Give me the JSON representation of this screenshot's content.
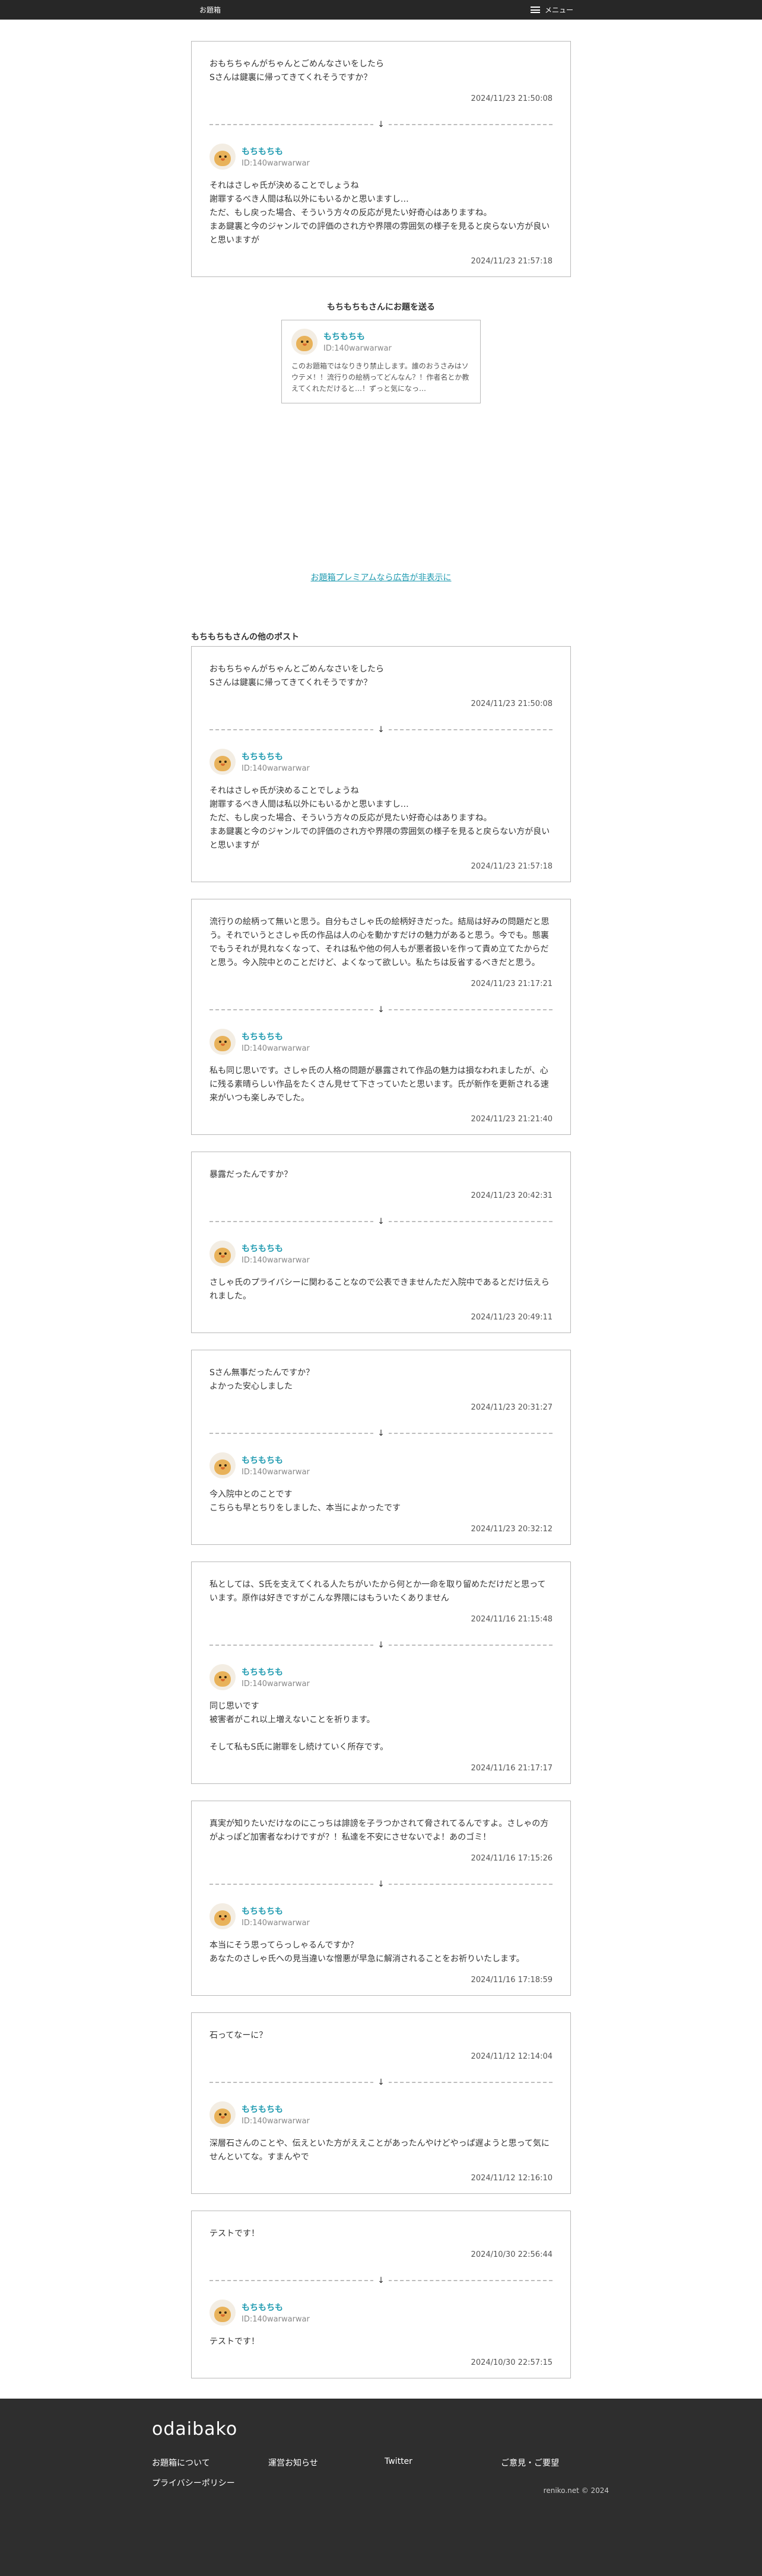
{
  "header": {
    "site_title": "お題箱",
    "menu_label": "メニュー"
  },
  "main_post": {
    "question": "おもちちゃんがちゃんとごめんなさいをしたら\nSさんは鍵裏に帰ってきてくれそうですか？",
    "question_time": "2024/11/23 21:50:08",
    "author_name": "もちもちも",
    "author_id": "ID:140warwarwar",
    "answer": "それはさしゃ氏が決めることでしょうね\n謝罪するべき人間は私以外にもいるかと思いますし…\nただ、もし戻った場合、そういう方々の反応が見たい好奇心はありますね。\nまあ鍵裏と今のジャンルでの評価のされ方や界隈の雰囲気の様子を見ると戻らない方が良いと思いますが",
    "answer_time": "2024/11/23 21:57:18"
  },
  "share": {
    "title": "もちもちもさんにお題を送る",
    "author_name": "もちもちも",
    "author_id": "ID:140warwarwar",
    "bio": "このお題箱ではなりきり禁止します。誰のおうさみはソウテメ！！流行りの絵柄ってどんなん？！作者名とか教えてくれただけると…！ずっと気になっ…"
  },
  "ad_link": "お題箱プレミアムなら広告が非表示に",
  "other_posts_title": "もちもちもさんの他のポスト",
  "posts": [
    {
      "question": "おもちちゃんがちゃんとごめんなさいをしたら\nSさんは鍵裏に帰ってきてくれそうですか？",
      "question_time": "2024/11/23 21:50:08",
      "author_name": "もちもちも",
      "author_id": "ID:140warwarwar",
      "answer": "それはさしゃ氏が決めることでしょうね\n謝罪するべき人間は私以外にもいるかと思いますし…\nただ、もし戻った場合、そういう方々の反応が見たい好奇心はありますね。\nまあ鍵裏と今のジャンルでの評価のされ方や界隈の雰囲気の様子を見ると戻らない方が良いと思いますが",
      "answer_time": "2024/11/23 21:57:18"
    },
    {
      "question": "流行りの絵柄って無いと思う。自分もさしゃ氏の絵柄好きだった。結局は好みの問題だと思う。それでいうとさしゃ氏の作品は人の心を動かすだけの魅力があると思う。今でも。態裏でもうそれが見れなくなって、それは私や他の何人もが悪者扱いを作って責め立てたからだと思う。今入院中とのことだけど、よくなって欲しい。私たちは反省するべきだと思う。",
      "question_time": "2024/11/23 21:17:21",
      "author_name": "もちもちも",
      "author_id": "ID:140warwarwar",
      "answer": "私も同じ思いです。さしゃ氏の人格の問題が暴露されて作品の魅力は損なわれましたが、心に残る素晴らしい作品をたくさん見せて下さっていたと思います。氏が新作を更新される速来がいつも楽しみでした。",
      "answer_time": "2024/11/23 21:21:40"
    },
    {
      "question": "暴露だったんですか？",
      "question_time": "2024/11/23 20:42:31",
      "author_name": "もちもちも",
      "author_id": "ID:140warwarwar",
      "answer": "さしゃ氏のプライバシーに関わることなので公表できませんただ入院中であるとだけ伝えられました。",
      "answer_time": "2024/11/23 20:49:11"
    },
    {
      "question": "Sさん無事だったんですか？\nよかった安心しました",
      "question_time": "2024/11/23 20:31:27",
      "author_name": "もちもちも",
      "author_id": "ID:140warwarwar",
      "answer": "今入院中とのことです\nこちらも早とちりをしました、本当によかったです",
      "answer_time": "2024/11/23 20:32:12"
    },
    {
      "question": "私としては、S氏を支えてくれる人たちがいたから何とか一命を取り留めただけだと思っています。原作は好きですがこんな界隈にはもういたくありません",
      "question_time": "2024/11/16 21:15:48",
      "author_name": "もちもちも",
      "author_id": "ID:140warwarwar",
      "answer": "同じ思いです\n被害者がこれ以上増えないことを祈ります。\n\nそして私もS氏に謝罪をし続けていく所存です。",
      "answer_time": "2024/11/16 21:17:17"
    },
    {
      "question": "真実が知りたいだけなのにこっちは誹謗を子ラつかされて脅されてるんですよ。さしゃの方がよっぽど加害者なわけですが？！私達を不安にさせないでよ！あのゴミ！",
      "question_time": "2024/11/16 17:15:26",
      "author_name": "もちもちも",
      "author_id": "ID:140warwarwar",
      "answer": "本当にそう思ってらっしゃるんですか？\nあなたのさしゃ氏への見当違いな憎悪が早急に解消されることをお祈りいたします。",
      "answer_time": "2024/11/16 17:18:59"
    },
    {
      "question": "石ってなーに？",
      "question_time": "2024/11/12 12:14:04",
      "author_name": "もちもちも",
      "author_id": "ID:140warwarwar",
      "answer": "深層石さんのことや、伝えといた方がええことがあったんやけどやっぱ遅ようと思って気にせんといてな。すまんやで",
      "answer_time": "2024/11/12 12:16:10"
    },
    {
      "question": "テストです！",
      "question_time": "2024/10/30 22:56:44",
      "author_name": "もちもちも",
      "author_id": "ID:140warwarwar",
      "answer": "テストです！",
      "answer_time": "2024/10/30 22:57:15"
    }
  ],
  "footer": {
    "logo": "odaibako",
    "links": [
      "お題箱について",
      "運営お知らせ",
      "Twitter",
      "ご意見・ご要望",
      "プライバシーポリシー"
    ],
    "copyright": "reniko.net © 2024"
  },
  "colors": {
    "accent": "#1e9ab0",
    "header_bg": "#272727",
    "footer_bg": "#2e2e2e",
    "border": "#b9b9b9"
  },
  "icons": {
    "menu": "hamburger-icon",
    "arrow": "arrow-down-icon",
    "avatar": "chick-avatar"
  }
}
